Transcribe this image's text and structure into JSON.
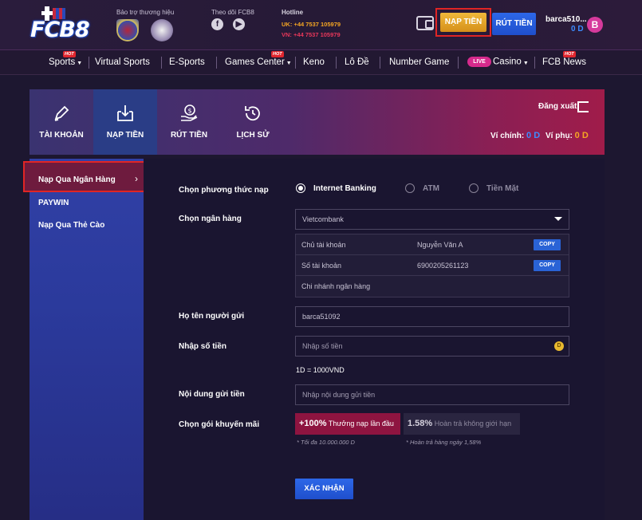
{
  "header": {
    "logo_text": "FCB8",
    "sponsor_label": "Bảo trợ thương hiệu",
    "follow_label": "Theo dõi FCB8",
    "hotline_label": "Hotline",
    "hotline_uk_prefix": "UK:",
    "hotline_uk": "+44 7537 105979",
    "hotline_vn_prefix": "VN:",
    "hotline_vn": "+44 7537 105979",
    "deposit_button": "NẠP TIỀN",
    "withdraw_button": "RÚT TIỀN",
    "username": "barca510...",
    "balance": "0 D",
    "avatar_letter": "B"
  },
  "nav": {
    "items": [
      {
        "label": "Sports",
        "hot": true,
        "dropdown": true
      },
      {
        "label": "Virtual Sports"
      },
      {
        "label": "E-Sports"
      },
      {
        "label": "Games Center",
        "hot": true,
        "dropdown": true
      },
      {
        "label": "Keno"
      },
      {
        "label": "Lô Đề"
      },
      {
        "label": "Number Game"
      },
      {
        "label": "Casino",
        "live": true,
        "dropdown": true
      },
      {
        "label": "FCB News",
        "hot": true
      }
    ],
    "hot_tag": "HOT",
    "live_tag": "LIVE"
  },
  "account_bar": {
    "tabs": [
      {
        "label": "TÀI KHOẢN",
        "icon": "pencil-icon"
      },
      {
        "label": "NẠP TIỀN",
        "icon": "download-box-icon",
        "active": true
      },
      {
        "label": "RÚT TIỀN",
        "icon": "money-hand-icon"
      },
      {
        "label": "LỊCH SỬ",
        "icon": "history-icon"
      }
    ],
    "logout_label": "Đăng xuất",
    "main_wallet_label": "Ví chính:",
    "main_wallet_value": "0 D",
    "sub_wallet_label": "Ví phụ:",
    "sub_wallet_value": "0 D"
  },
  "sidebar": {
    "items": [
      {
        "label": "Nạp Qua Ngân Hàng",
        "active": true
      },
      {
        "label": "PAYWIN"
      },
      {
        "label": "Nạp Qua Thẻ Cào"
      }
    ]
  },
  "form": {
    "method_label": "Chọn phương thức nạp",
    "methods": [
      {
        "label": "Internet Banking",
        "checked": true
      },
      {
        "label": "ATM"
      },
      {
        "label": "Tiền Mặt"
      }
    ],
    "bank_label": "Chọn ngân hàng",
    "bank_selected": "Vietcombank",
    "bank_info": {
      "owner_label": "Chủ tài khoản",
      "owner_value": "Nguyễn Văn A",
      "account_label": "Số tài khoản",
      "account_value": "6900205261123",
      "branch_label": "Chi nhánh ngân hàng",
      "copy_label": "COPY"
    },
    "sender_label": "Họ tên người gửi",
    "sender_value": "barca51092",
    "amount_label": "Nhập số tiền",
    "amount_placeholder": "Nhập số tiền",
    "coin_symbol": "D",
    "rate_text": "1D = 1000VND",
    "content_label": "Nội dung gửi tiền",
    "content_placeholder": "Nhập nội dung gửi tiền",
    "promo_label": "Chọn gói khuyến mãi",
    "promo_1_value": "+100%",
    "promo_1_text": "Thưởng nạp lần đầu",
    "promo_1_note": "* Tối đa 10.000.000 D",
    "promo_2_value": "1.58%",
    "promo_2_text": "Hoàn trả không giới hạn",
    "promo_2_note": "* Hoàn trả hàng ngày 1,58%",
    "submit_label": "XÁC NHẬN"
  },
  "colors": {
    "accent_blue": "#2d67e8",
    "accent_gold": "#f0b83a",
    "highlight_red": "#e02525",
    "balance_blue": "#3d8cff",
    "sub_wallet_orange": "#f5a623"
  }
}
